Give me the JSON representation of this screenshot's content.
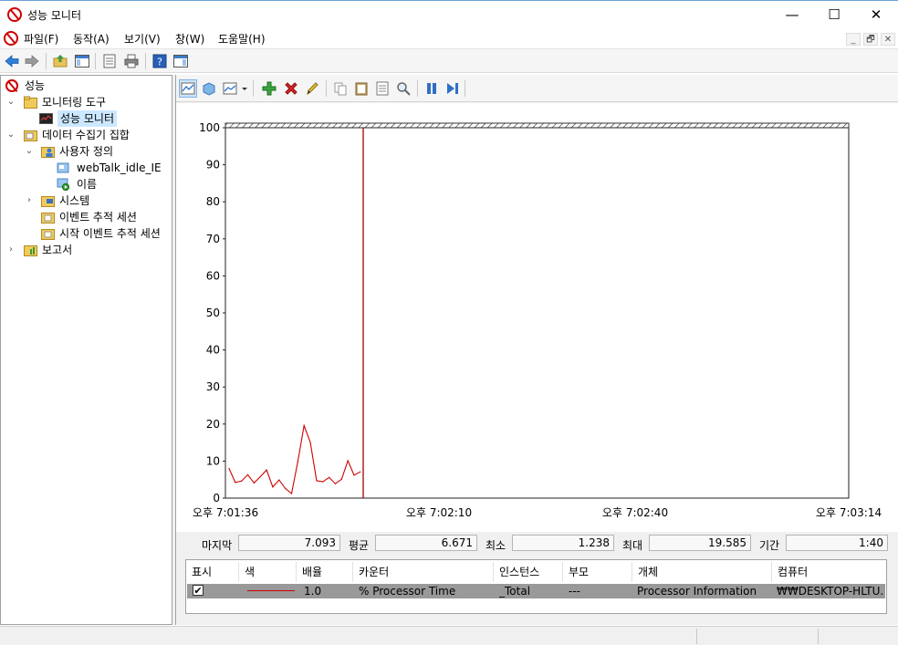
{
  "window": {
    "title": "성능 모니터",
    "minimize": "—",
    "maximize": "☐",
    "close": "✕"
  },
  "menu": {
    "items": [
      "파일(F)",
      "동작(A)",
      "보기(V)",
      "창(W)",
      "도움말(H)"
    ],
    "mdi": [
      "_",
      "🗗",
      "✕"
    ]
  },
  "tree": {
    "root": "성능",
    "monitoring_tools": "모니터링 도구",
    "perf_monitor": "성능 모니터",
    "data_collector_sets": "데이터 수집기 집합",
    "user_defined": "사용자 정의",
    "webtalk": "webTalk_idle_IE",
    "name_item": "이름",
    "system": "시스템",
    "event_trace": "이벤트 추적 세션",
    "startup_event_trace": "시작 이벤트 추적 세션",
    "reports": "보고서"
  },
  "chart_data": {
    "type": "line",
    "ylim": [
      0,
      100
    ],
    "y_ticks": [
      "100",
      "90",
      "80",
      "70",
      "60",
      "50",
      "40",
      "30",
      "20",
      "10",
      "0"
    ],
    "x_tick_labels": [
      "오후 7:01:36",
      "오후 7:02:10",
      "오후 7:02:40",
      "오후 7:03:14"
    ],
    "series": [
      {
        "color": "#cc0000",
        "values": [
          8,
          4.2,
          4.6,
          6.3,
          4.1,
          5.8,
          7.6,
          3.0,
          4.9,
          2.6,
          1.24,
          9.8,
          19.585,
          15.0,
          4.7,
          4.4,
          5.6,
          3.9,
          5.1,
          10.1,
          6.2,
          7.093
        ]
      }
    ],
    "cursor_color": "#a00000",
    "grid": false
  },
  "stats": {
    "last_label": "마지막",
    "last_value": "7.093",
    "avg_label": "평균",
    "avg_value": "6.671",
    "min_label": "최소",
    "min_value": "1.238",
    "max_label": "최대",
    "max_value": "19.585",
    "duration_label": "기간",
    "duration_value": "1:40"
  },
  "table": {
    "headers": [
      "표시",
      "색",
      "배율",
      "카운터",
      "인스턴스",
      "부모",
      "개체",
      "컴퓨터"
    ],
    "row": {
      "checked": "✔",
      "scale": "1.0",
      "counter": "% Processor Time",
      "instance": "_Total",
      "parent": "---",
      "object": "Processor Information",
      "computer": "₩₩DESKTOP-HLTU..."
    },
    "line_color": "#d00000"
  }
}
